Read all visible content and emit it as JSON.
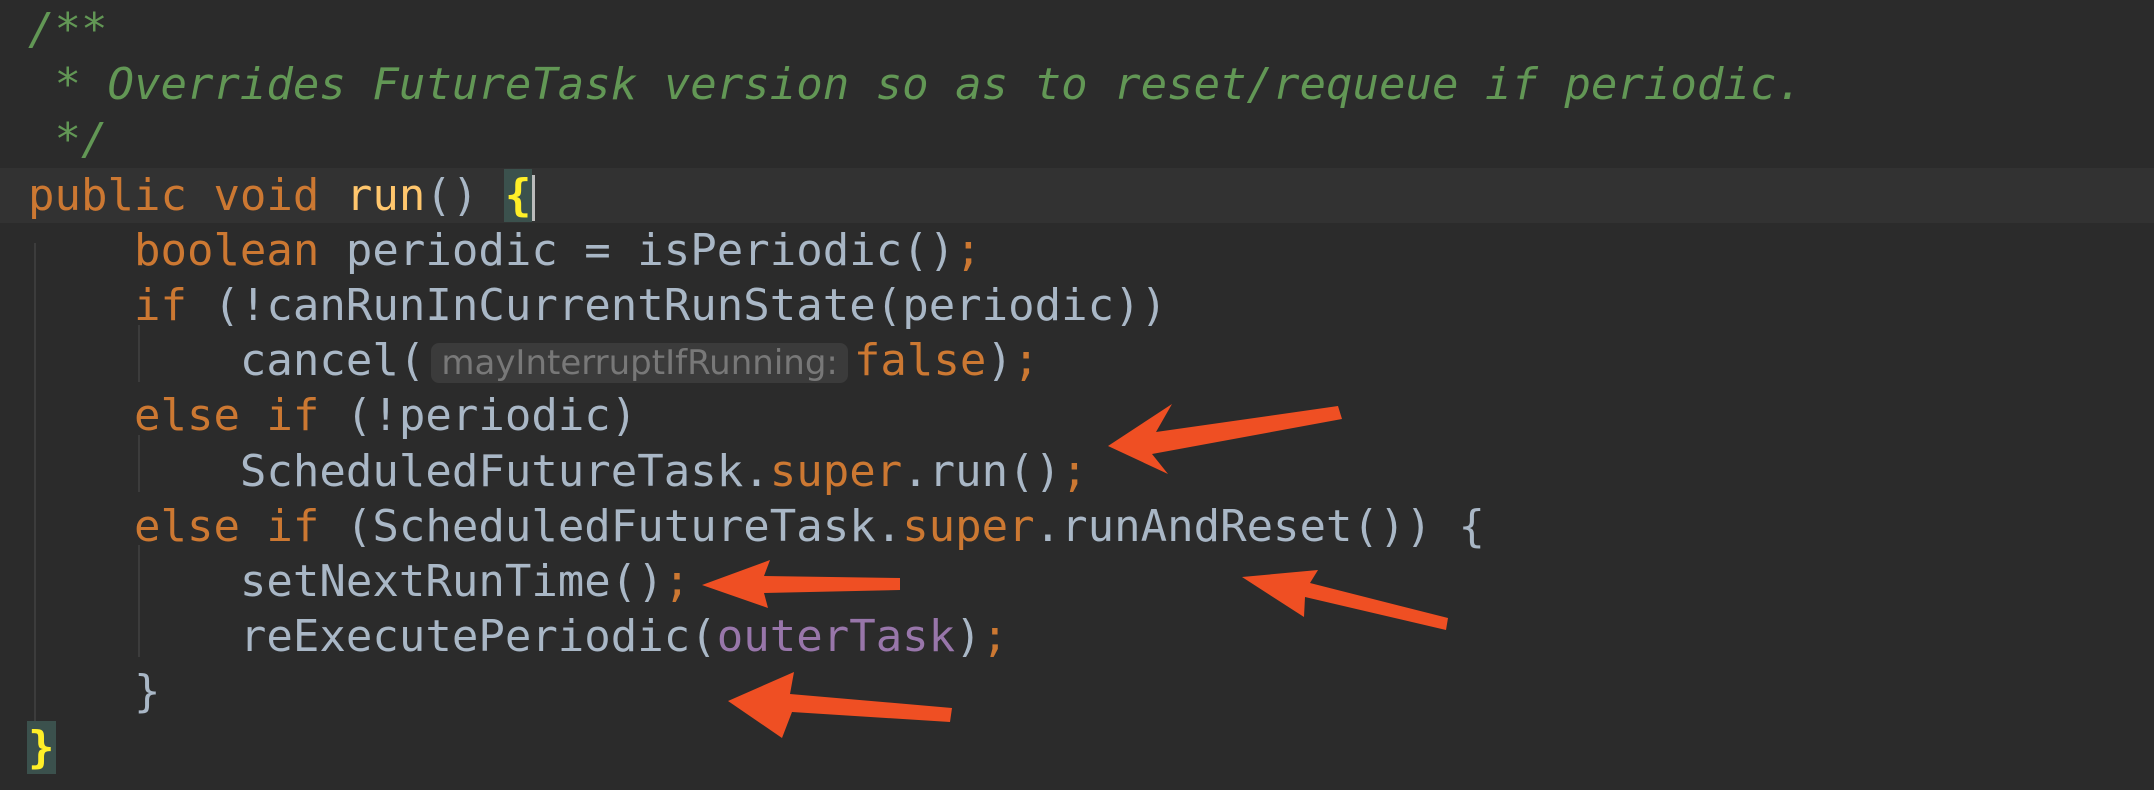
{
  "editor": {
    "lines": [
      {
        "id": "l1",
        "tokens": [
          {
            "t": "/**",
            "c": "comment"
          }
        ]
      },
      {
        "id": "l2",
        "tokens": [
          {
            "t": " * Overrides FutureTask version so as to reset/requeue if periodic.",
            "c": "comment"
          }
        ]
      },
      {
        "id": "l3",
        "tokens": [
          {
            "t": " */",
            "c": "comment"
          }
        ]
      },
      {
        "id": "l4",
        "current": true,
        "tokens": [
          {
            "t": "public ",
            "c": "kw"
          },
          {
            "t": "void ",
            "c": "kw"
          },
          {
            "t": "run",
            "c": "fn"
          },
          {
            "t": "() ",
            "c": "plain"
          },
          {
            "t": "{",
            "c": "brace-hl"
          },
          {
            "t": "",
            "c": "caret"
          }
        ]
      },
      {
        "id": "l5",
        "tokens": [
          {
            "t": "    "
          },
          {
            "t": "boolean ",
            "c": "kw"
          },
          {
            "t": "periodic = isPeriodic()",
            "c": "plain"
          },
          {
            "t": ";",
            "c": "kw"
          }
        ]
      },
      {
        "id": "l6",
        "tokens": [
          {
            "t": "    "
          },
          {
            "t": "if ",
            "c": "kw"
          },
          {
            "t": "(!canRunInCurrentRunState(periodic))",
            "c": "plain"
          }
        ]
      },
      {
        "id": "l7",
        "tokens": [
          {
            "t": "        "
          },
          {
            "t": "cancel(",
            "c": "plain"
          },
          {
            "t": "mayInterruptIfRunning:",
            "c": "hint"
          },
          {
            "t": "false",
            "c": "kw"
          },
          {
            "t": ")",
            "c": "plain"
          },
          {
            "t": ";",
            "c": "kw"
          }
        ]
      },
      {
        "id": "l8",
        "tokens": [
          {
            "t": "    "
          },
          {
            "t": "else if ",
            "c": "kw"
          },
          {
            "t": "(!periodic)",
            "c": "plain"
          }
        ]
      },
      {
        "id": "l9",
        "tokens": [
          {
            "t": "        "
          },
          {
            "t": "ScheduledFutureTask.",
            "c": "plain"
          },
          {
            "t": "super",
            "c": "kw"
          },
          {
            "t": ".run()",
            "c": "plain"
          },
          {
            "t": ";",
            "c": "kw"
          }
        ]
      },
      {
        "id": "l10",
        "tokens": [
          {
            "t": "    "
          },
          {
            "t": "else if ",
            "c": "kw"
          },
          {
            "t": "(ScheduledFutureTask.",
            "c": "plain"
          },
          {
            "t": "super",
            "c": "kw"
          },
          {
            "t": ".runAndReset()) {",
            "c": "plain"
          }
        ]
      },
      {
        "id": "l11",
        "tokens": [
          {
            "t": "        "
          },
          {
            "t": "setNextRunTime()",
            "c": "plain"
          },
          {
            "t": ";",
            "c": "kw"
          }
        ]
      },
      {
        "id": "l12",
        "tokens": [
          {
            "t": "        "
          },
          {
            "t": "reExecutePeriodic(",
            "c": "plain"
          },
          {
            "t": "outerTask",
            "c": "field"
          },
          {
            "t": ")",
            "c": "plain"
          },
          {
            "t": ";",
            "c": "kw"
          }
        ]
      },
      {
        "id": "l13",
        "tokens": [
          {
            "t": "    "
          },
          {
            "t": "}",
            "c": "plain"
          }
        ]
      },
      {
        "id": "l14",
        "tokens": [
          {
            "t": "}",
            "c": "brace-hl"
          }
        ]
      }
    ]
  },
  "colors": {
    "background": "#2b2b2b",
    "current_line": "#323232",
    "comment": "#629755",
    "keyword": "#cc7832",
    "method_declaration": "#ffc66d",
    "identifier": "#a9b7c6",
    "field": "#9876aa",
    "inlay_hint_text": "#787878",
    "brace_match": "#ffef28",
    "annotation_arrow": "#ef4f23"
  },
  "annotations": [
    {
      "icon": "red-arrow",
      "points_to": "ScheduledFutureTask.super.run();"
    },
    {
      "icon": "red-arrow",
      "points_to": "setNextRunTime();"
    },
    {
      "icon": "red-arrow",
      "points_to": "ScheduledFutureTask.super.runAndReset()"
    },
    {
      "icon": "red-arrow",
      "points_to": "reExecutePeriodic(outerTask);"
    }
  ]
}
